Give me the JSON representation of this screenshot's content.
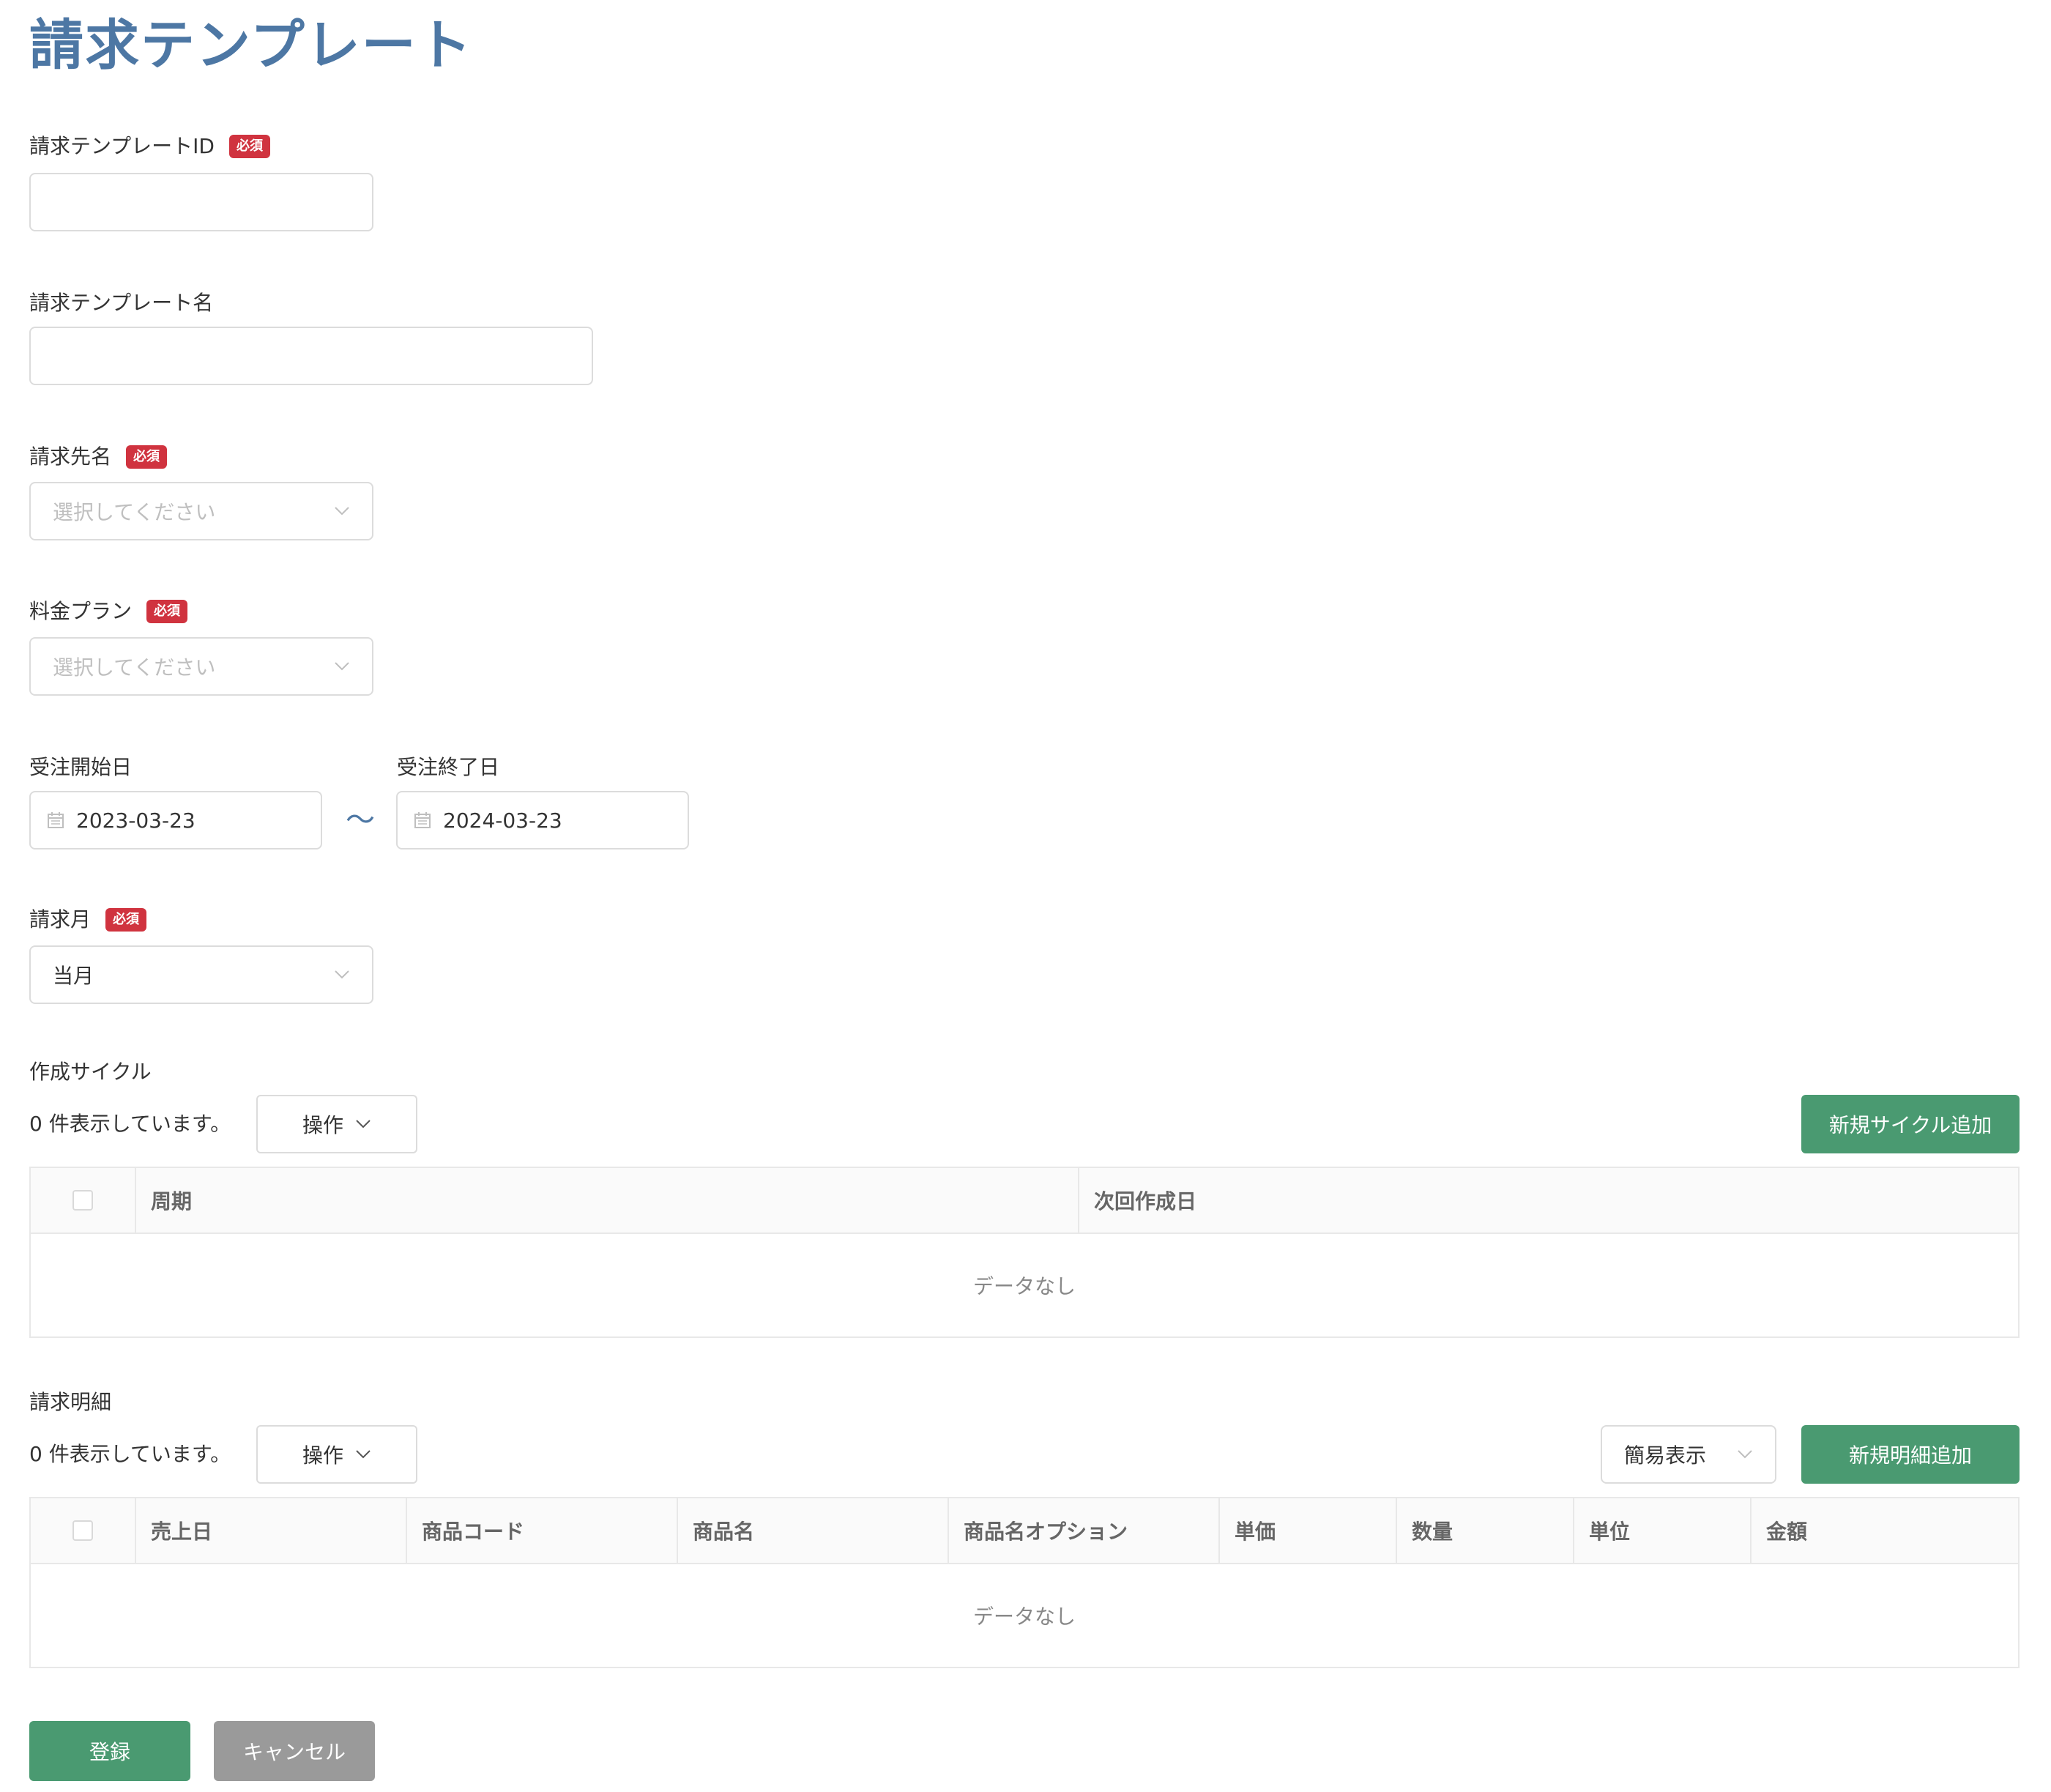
{
  "page_title": "請求テンプレート",
  "fields": {
    "template_id": {
      "label": "請求テンプレートID",
      "required_badge": "必須",
      "value": ""
    },
    "template_name": {
      "label": "請求テンプレート名",
      "value": ""
    },
    "billing_to": {
      "label": "請求先名",
      "required_badge": "必須",
      "placeholder": "選択してください"
    },
    "plan": {
      "label": "料金プラン",
      "required_badge": "必須",
      "placeholder": "選択してください"
    },
    "order_start": {
      "label": "受注開始日",
      "value": "2023-03-23"
    },
    "range_separator": "～",
    "order_end": {
      "label": "受注終了日",
      "value": "2024-03-23"
    },
    "billing_month": {
      "label": "請求月",
      "required_badge": "必須",
      "value": "当月"
    }
  },
  "cycle_section": {
    "title": "作成サイクル",
    "count_text": "0 件表示しています。",
    "operation_label": "操作",
    "add_button": "新規サイクル追加",
    "columns": [
      "周期",
      "次回作成日"
    ],
    "empty_text": "データなし"
  },
  "detail_section": {
    "title": "請求明細",
    "count_text": "0 件表示しています。",
    "operation_label": "操作",
    "view_mode": "簡易表示",
    "add_button": "新規明細追加",
    "columns": [
      "売上日",
      "商品コード",
      "商品名",
      "商品名オプション",
      "単価",
      "数量",
      "単位",
      "金額"
    ],
    "empty_text": "データなし"
  },
  "footer": {
    "register_button": "登録",
    "cancel_button": "キャンセル"
  },
  "colors": {
    "title": "#4d77a4",
    "required_badge": "#d0333f",
    "primary_button": "#4a9a71",
    "cancel_button": "#9a9a9a"
  }
}
